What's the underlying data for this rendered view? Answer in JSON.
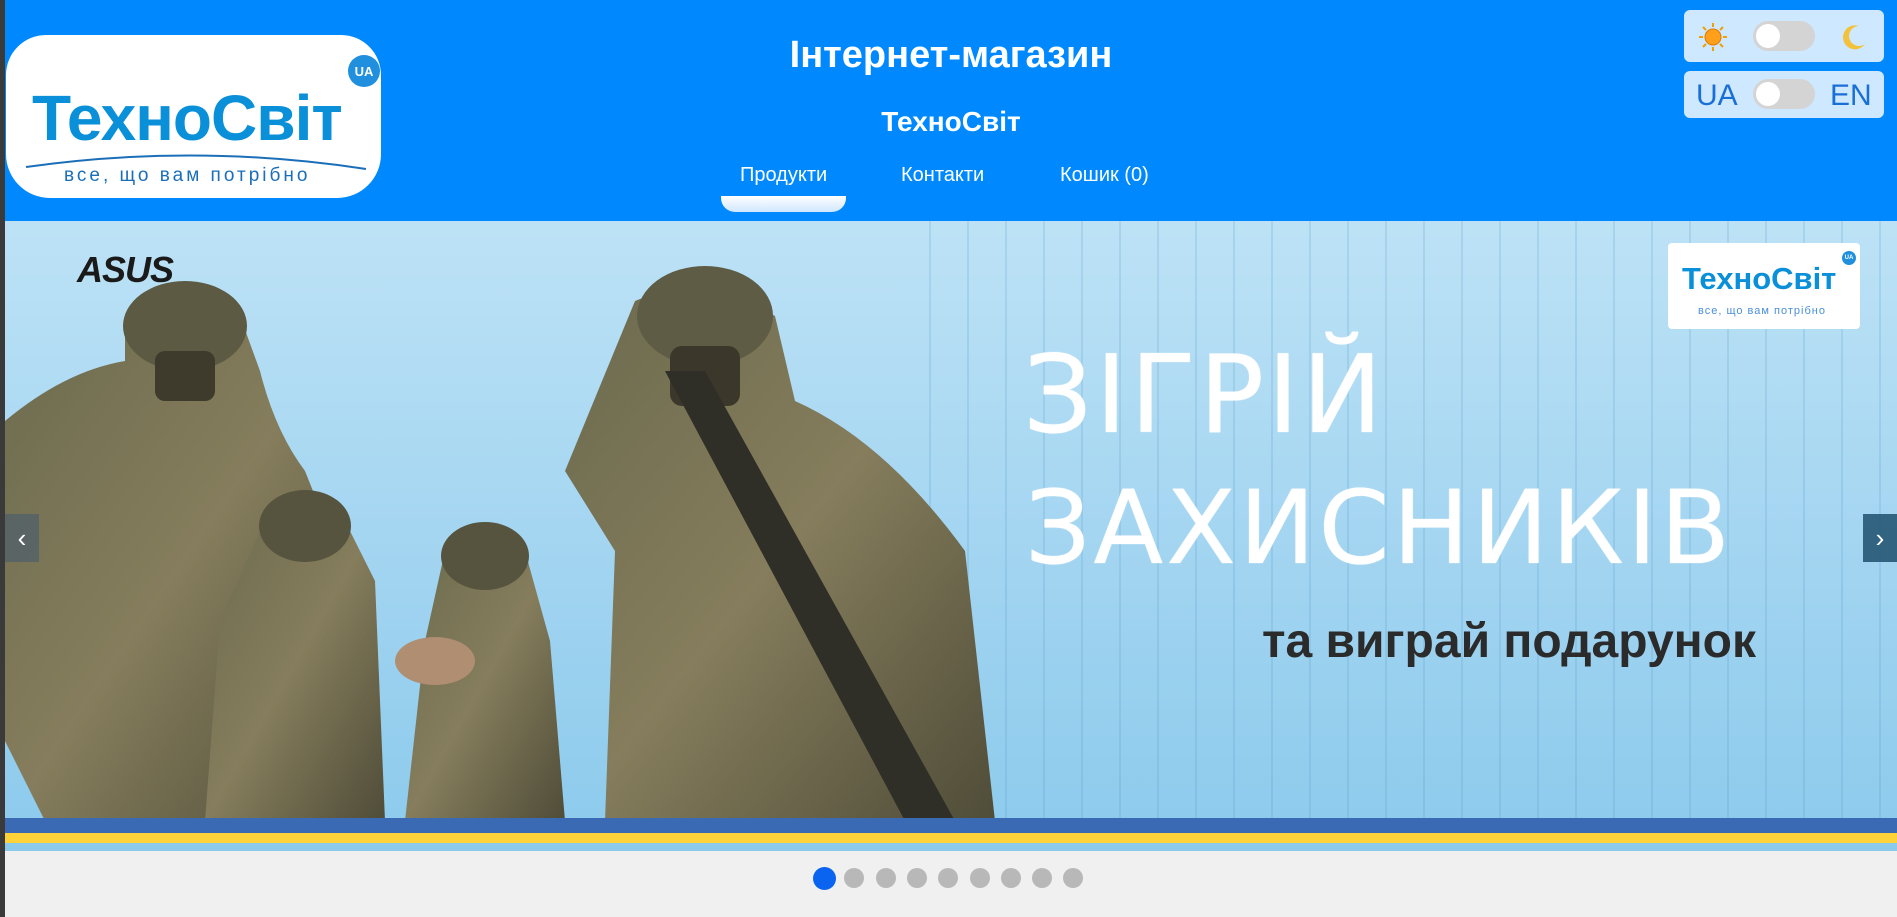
{
  "header": {
    "logo": {
      "word": "ТехноСвіт",
      "tagline": "все, що вам потрібно",
      "badge": "UA"
    },
    "title": "Інтернет-магазин",
    "subtitle": "ТехноСвіт",
    "nav": [
      {
        "label": "Продукти",
        "active": true
      },
      {
        "label": "Контакти",
        "active": false
      },
      {
        "label": "Кошик (0)",
        "active": false
      }
    ],
    "colors": {
      "header_bg": "#0089ff",
      "active_indicator": "#ffffff"
    }
  },
  "toggles": {
    "theme": {
      "left_icon": "sun-icon",
      "right_icon": "moon-icon",
      "state": "light"
    },
    "language": {
      "left_label": "UA",
      "right_label": "EN",
      "state": "UA"
    }
  },
  "carousel": {
    "slide": {
      "brand": "ASUS",
      "logo_word": "ТехноСвіт",
      "logo_tagline": "все, що вам потрібно",
      "logo_badge": "UA",
      "headline_line1": "ЗІГРІЙ",
      "headline_line2": "ЗАХИСНИКІВ",
      "subline": "та виграй подарунок"
    },
    "prev_label": "‹",
    "next_label": "›",
    "dot_count": 9,
    "active_index": 0,
    "colors": {
      "active_dot": "#0b64f0",
      "inactive_dot": "#b8b8b8"
    }
  }
}
